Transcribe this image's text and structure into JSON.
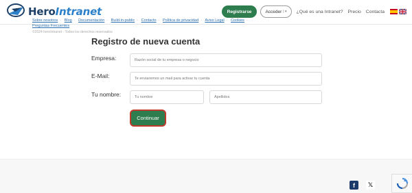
{
  "header": {
    "logo_hero": "Hero",
    "logo_intranet": "Intranet",
    "register_label": "Registrarse",
    "login_label": "Acceder",
    "nav_links": [
      "¿Qué es una Intranet?",
      "Precio",
      "Contacta"
    ],
    "flags": [
      "es-flag",
      "uk-flag"
    ]
  },
  "form": {
    "title": "Registro de nueva cuenta",
    "company_label": "Empresa:",
    "company_placeholder": "Razón social de tu empresa o negocio",
    "email_label": "E-Mail:",
    "email_placeholder": "Te enviaremos un mail para activar tu cuenta",
    "name_label": "Tu nombre:",
    "firstname_placeholder": "Tu nombre",
    "lastname_placeholder": "Apellidos",
    "continue_label": "Continuar"
  },
  "footer": {
    "links": [
      "Sobre nosotros",
      "Blog",
      "Documentación",
      "Build-in-public",
      "Contacto",
      "Política de privacidad",
      "Aviso Legal",
      "Cookies",
      "Preguntas Frecuentes"
    ],
    "copyright": "©2024 heroIntranet - Todos los derechos reservados"
  },
  "colors": {
    "brand_green": "#2e7d4f",
    "logo_dark": "#1e3f66",
    "logo_blue": "#2c7fc9",
    "focus_red": "#c0392b"
  }
}
